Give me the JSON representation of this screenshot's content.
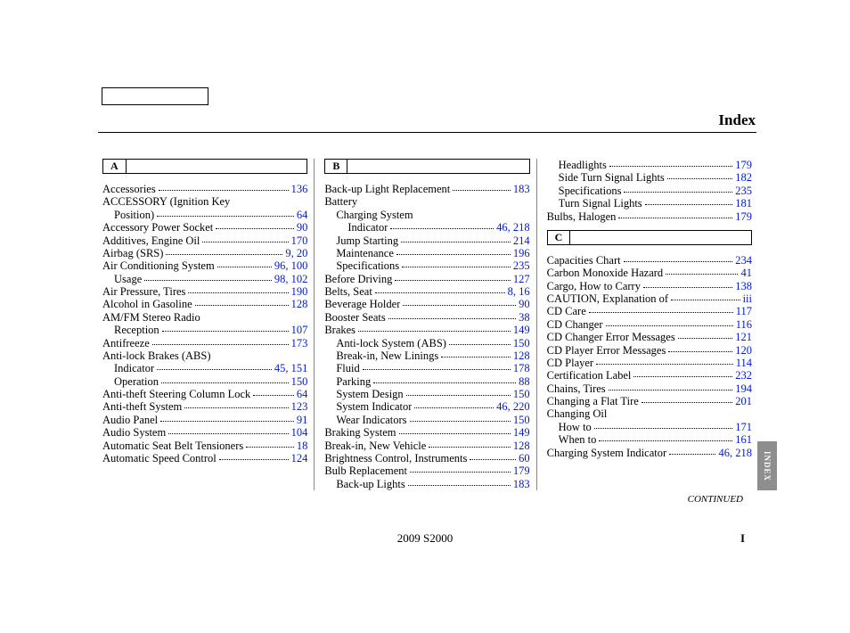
{
  "page_title": "Index",
  "letters": {
    "A": "A",
    "B": "B",
    "C": "C"
  },
  "col1": [
    {
      "label": "Accessories",
      "pages": "136"
    },
    {
      "label": "ACCESSORY (Ignition Key",
      "pages": "",
      "nolead": true
    },
    {
      "label": "Position)",
      "pages": "64",
      "indent": 1
    },
    {
      "label": "Accessory Power Socket",
      "pages": "90"
    },
    {
      "label": "Additives, Engine Oil",
      "pages": "170"
    },
    {
      "label": "Airbag (SRS)",
      "pages": "9, 20"
    },
    {
      "label": "Air Conditioning System",
      "pages": "96, 100"
    },
    {
      "label": "Usage",
      "pages": "98, 102",
      "indent": 1
    },
    {
      "label": "Air Pressure, Tires",
      "pages": "190"
    },
    {
      "label": "Alcohol in Gasoline",
      "pages": "128"
    },
    {
      "label": "AM/FM Stereo Radio",
      "pages": "",
      "nolead": true
    },
    {
      "label": "Reception",
      "pages": "107",
      "indent": 1
    },
    {
      "label": "Antifreeze",
      "pages": "173"
    },
    {
      "label": "Anti-lock Brakes (ABS)",
      "pages": "",
      "nolead": true
    },
    {
      "label": "Indicator",
      "pages": "45, 151",
      "indent": 1
    },
    {
      "label": "Operation",
      "pages": "150",
      "indent": 1
    },
    {
      "label": "Anti-theft Steering Column Lock",
      "pages": "64"
    },
    {
      "label": "Anti-theft System",
      "pages": "123"
    },
    {
      "label": "Audio Panel",
      "pages": "91"
    },
    {
      "label": "Audio System",
      "pages": "104"
    },
    {
      "label": "Automatic Seat Belt Tensioners",
      "pages": "18"
    },
    {
      "label": "Automatic Speed Control",
      "pages": "124"
    }
  ],
  "col2": [
    {
      "label": "Back-up Light Replacement",
      "pages": "183"
    },
    {
      "label": "Battery",
      "pages": "",
      "nolead": true
    },
    {
      "label": "Charging System",
      "pages": "",
      "nolead": true,
      "indent": 1
    },
    {
      "label": "Indicator",
      "pages": "46, 218",
      "indent": 2
    },
    {
      "label": "Jump Starting",
      "pages": "214",
      "indent": 1
    },
    {
      "label": "Maintenance",
      "pages": "196",
      "indent": 1
    },
    {
      "label": "Specifications",
      "pages": "235",
      "indent": 1
    },
    {
      "label": "Before Driving",
      "pages": "127"
    },
    {
      "label": "Belts, Seat",
      "pages": "8, 16"
    },
    {
      "label": "Beverage Holder",
      "pages": "90"
    },
    {
      "label": "Booster Seats",
      "pages": "38"
    },
    {
      "label": "Brakes",
      "pages": "149"
    },
    {
      "label": "Anti-lock System (ABS)",
      "pages": "150",
      "indent": 1
    },
    {
      "label": "Break-in, New Linings",
      "pages": "128",
      "indent": 1
    },
    {
      "label": "Fluid",
      "pages": "178",
      "indent": 1
    },
    {
      "label": "Parking",
      "pages": "88",
      "indent": 1
    },
    {
      "label": "System Design",
      "pages": "150",
      "indent": 1
    },
    {
      "label": "System Indicator",
      "pages": "46, 220",
      "indent": 1
    },
    {
      "label": "Wear Indicators",
      "pages": "150",
      "indent": 1
    },
    {
      "label": "Braking System",
      "pages": "149"
    },
    {
      "label": "Break-in, New Vehicle",
      "pages": "128"
    },
    {
      "label": "Brightness Control, Instruments",
      "pages": "60"
    },
    {
      "label": "Bulb Replacement",
      "pages": "179"
    },
    {
      "label": "Back-up Lights",
      "pages": "183",
      "indent": 1
    }
  ],
  "col3a": [
    {
      "label": "Headlights",
      "pages": "179",
      "indent": 1
    },
    {
      "label": "Side Turn Signal Lights",
      "pages": "182",
      "indent": 1
    },
    {
      "label": "Specifications",
      "pages": "235",
      "indent": 1
    },
    {
      "label": "Turn Signal Lights",
      "pages": "181",
      "indent": 1
    },
    {
      "label": "Bulbs, Halogen",
      "pages": "179"
    }
  ],
  "col3b": [
    {
      "label": "Capacities Chart",
      "pages": "234"
    },
    {
      "label": "Carbon Monoxide Hazard",
      "pages": "41"
    },
    {
      "label": "Cargo, How to Carry",
      "pages": "138"
    },
    {
      "label": "CAUTION, Explanation of",
      "pages": "iii"
    },
    {
      "label": "CD Care",
      "pages": "117"
    },
    {
      "label": "CD Changer",
      "pages": "116"
    },
    {
      "label": "CD Changer Error Messages",
      "pages": "121"
    },
    {
      "label": "CD Player Error Messages",
      "pages": "120"
    },
    {
      "label": "CD Player",
      "pages": "114"
    },
    {
      "label": "Certification Label",
      "pages": "232"
    },
    {
      "label": "Chains, Tires",
      "pages": "194"
    },
    {
      "label": "Changing a Flat Tire",
      "pages": "201"
    },
    {
      "label": "Changing Oil",
      "pages": "",
      "nolead": true
    },
    {
      "label": "How to",
      "pages": "171",
      "indent": 1
    },
    {
      "label": "When to",
      "pages": "161",
      "indent": 1
    },
    {
      "label": "Charging System Indicator",
      "pages": "46, 218"
    }
  ],
  "continued": "CONTINUED",
  "side_tab": "INDEX",
  "footer_title": "2009  S2000",
  "footer_page": "I"
}
